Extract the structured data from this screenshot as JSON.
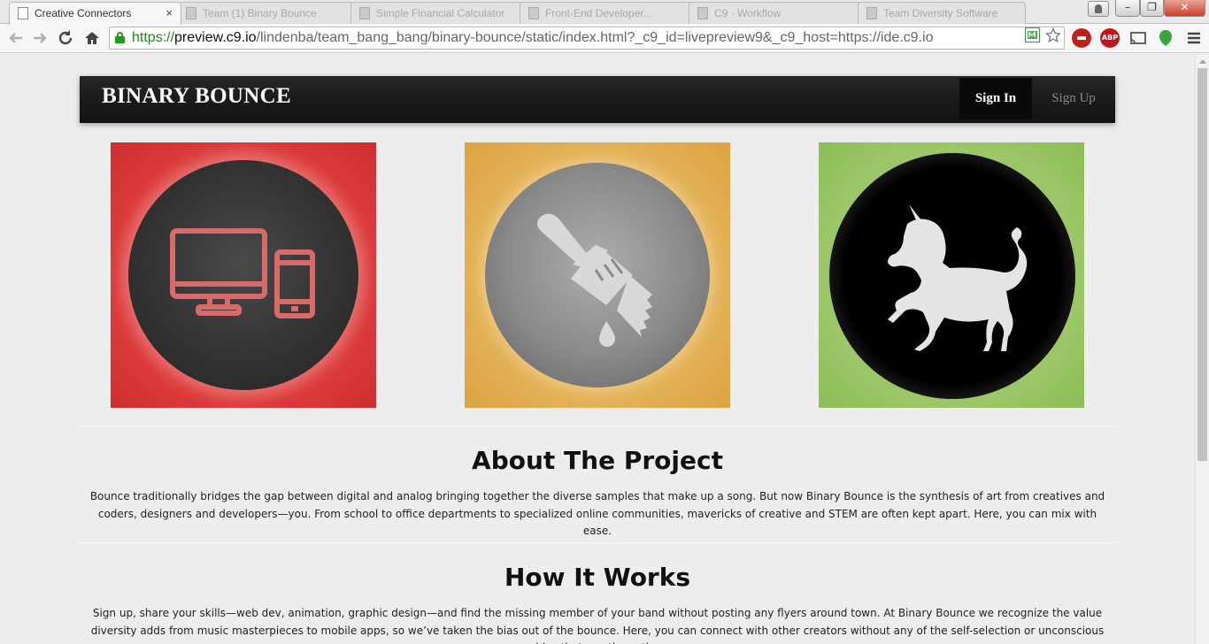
{
  "browser": {
    "tabs": [
      {
        "title": "Creative Connectors",
        "active": true
      },
      {
        "title": "Team (1) Binary Bounce",
        "active": false
      },
      {
        "title": "Simple Financial Calculator",
        "active": false
      },
      {
        "title": "Front-End Developer...",
        "active": false
      },
      {
        "title": "C9 · Workflow",
        "active": false
      },
      {
        "title": "Team Diversity Software",
        "active": false
      }
    ],
    "close_glyph": "×",
    "url_scheme": "https://",
    "url_host": "preview.c9.io",
    "url_path": "/lindenba/team_bang_bang/binary-bounce/static/index.html?_c9_id=livepreview9&_c9_host=https://ide.c9.io",
    "abp_label": "ABP",
    "window_controls": {
      "minimize": "–",
      "maximize": "❐",
      "close": "✕"
    }
  },
  "site": {
    "brand": "BINARY BOUNCE",
    "nav": {
      "sign_in": "Sign In",
      "sign_up": "Sign Up"
    },
    "tiles": [
      {
        "name": "devices",
        "icon": "computer-phone-icon",
        "color": "#d9393a"
      },
      {
        "name": "design",
        "icon": "paintbrush-icon",
        "color": "#dca23e"
      },
      {
        "name": "creative",
        "icon": "unicorn-icon",
        "color": "#8dbd55"
      }
    ],
    "about": {
      "title": "About The Project",
      "body": "Bounce traditionally bridges the gap between digital and analog bringing together the diverse samples that make up a song. But now Binary Bounce is the synthesis of art from creatives and coders, designers and developers—you. From school to office departments to specialized online communities, mavericks of creative and STEM are often kept apart. Here, you can mix with ease."
    },
    "how": {
      "title": "How It Works",
      "body": "Sign up, share your skills—web dev, animation, graphic design—and find the missing member of your band without posting any flyers around town. At Binary Bounce we recognize the value diversity adds from music masterpieces to mobile apps, so we’ve taken the bias out of the bounce. Here, you can connect with other creators without any of the self-selection or unconscious bias that can throw the"
    }
  }
}
